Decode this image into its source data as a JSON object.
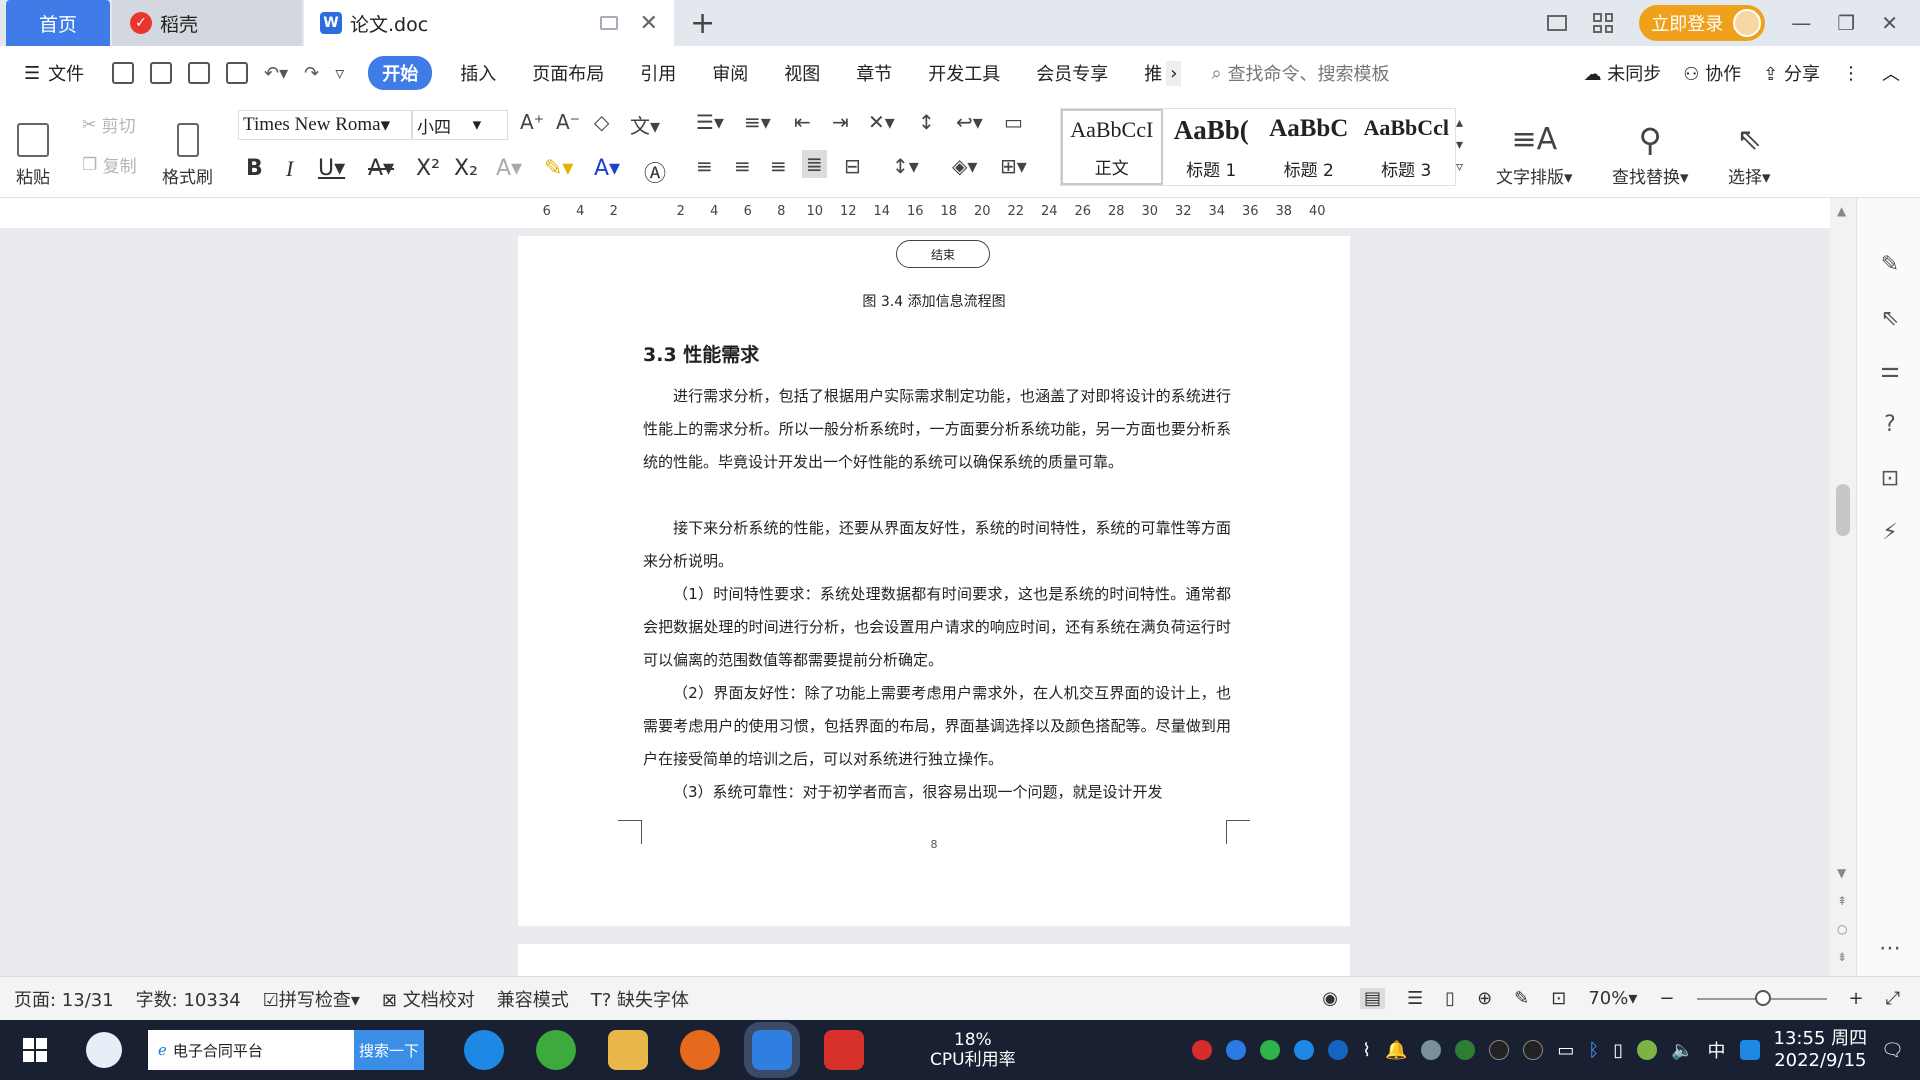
{
  "tabs": {
    "home": "首页",
    "daoke": "稻壳",
    "doc": "论文.doc"
  },
  "title_bar": {
    "login": "立即登录"
  },
  "menu": {
    "file": "文件",
    "items": [
      "开始",
      "插入",
      "页面布局",
      "引用",
      "审阅",
      "视图",
      "章节",
      "开发工具",
      "会员专享",
      "推"
    ],
    "more": "›",
    "search_placeholder": "查找命令、搜索模板",
    "unsync": "未同步",
    "collab": "协作",
    "share": "分享"
  },
  "ribbon": {
    "paste": "粘贴",
    "cut": "剪切",
    "copy": "复制",
    "format_painter": "格式刷",
    "font_name": "Times New Roma",
    "font_size": "小四",
    "styles": [
      {
        "preview": "AaBbCcI",
        "name": "正文"
      },
      {
        "preview": "AaBb(",
        "name": "标题 1"
      },
      {
        "preview": "AaBbC",
        "name": "标题 2"
      },
      {
        "preview": "AaBbCcl",
        "name": "标题 3"
      }
    ],
    "text_layout": "文字排版",
    "find_replace": "查找替换",
    "select": "选择"
  },
  "ruler": {
    "ticks": [
      "6",
      "4",
      "2",
      "",
      "2",
      "4",
      "6",
      "8",
      "10",
      "12",
      "14",
      "16",
      "18",
      "20",
      "22",
      "24",
      "26",
      "28",
      "30",
      "32",
      "34",
      "36",
      "38",
      "40"
    ]
  },
  "document": {
    "flow_end": "结束",
    "figure_caption": "图 3.4  添加信息流程图",
    "heading": "3.3  性能需求",
    "paragraphs": [
      "进行需求分析，包括了根据用户实际需求制定功能，也涵盖了对即将设计的系统进行性能上的需求分析。所以一般分析系统时，一方面要分析系统功能，另一方面也要分析系统的性能。毕竟设计开发出一个好性能的系统可以确保系统的质量可靠。",
      "接下来分析系统的性能，还要从界面友好性，系统的时间特性，系统的可靠性等方面来分析说明。",
      "（1）时间特性要求：系统处理数据都有时间要求，这也是系统的时间特性。通常都会把数据处理的时间进行分析，也会设置用户请求的响应时间，还有系统在满负荷运行时可以偏离的范围数值等都需要提前分析确定。",
      "（2）界面友好性：除了功能上需要考虑用户需求外，在人机交互界面的设计上，也需要考虑用户的使用习惯，包括界面的布局，界面基调选择以及颜色搭配等。尽量做到用户在接受简单的培训之后，可以对系统进行独立操作。",
      "（3）系统可靠性：对于初学者而言，很容易出现一个问题，就是设计开发"
    ],
    "page_number": "8"
  },
  "status": {
    "page": "页面: 13/31",
    "words": "字数: 10334",
    "spell": "拼写检查",
    "proof": "文档校对",
    "compat": "兼容模式",
    "missing_font": "缺失字体",
    "zoom": "70%"
  },
  "taskbar": {
    "search_text": "电子合同平台",
    "search_button": "搜索一下",
    "cpu_percent": "18%",
    "cpu_label": "CPU利用率",
    "ime": "中",
    "time": "13:55 周四",
    "date": "2022/9/15"
  },
  "colors": {
    "accent": "#3f7ce8",
    "login": "#f0a11c",
    "taskbar": "#182032"
  }
}
